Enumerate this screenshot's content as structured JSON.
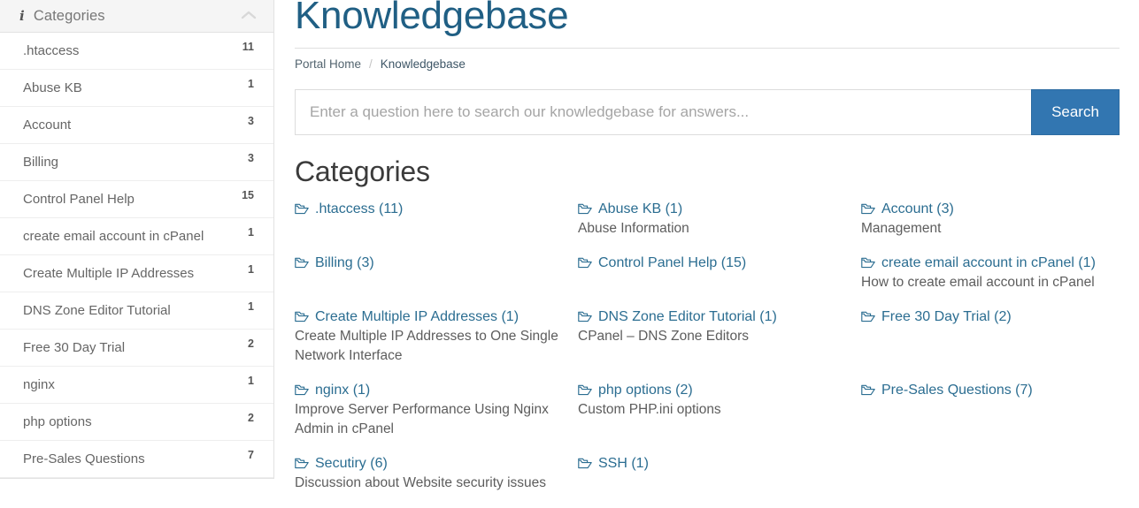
{
  "sidebar": {
    "title": "Categories",
    "info_icon": "info-icon",
    "collapse_icon": "chevron-up-icon",
    "items": [
      {
        "label": ".htaccess",
        "count": "11"
      },
      {
        "label": "Abuse KB",
        "count": "1"
      },
      {
        "label": "Account",
        "count": "3"
      },
      {
        "label": "Billing",
        "count": "3"
      },
      {
        "label": "Control Panel Help",
        "count": "15"
      },
      {
        "label": "create email account in cPanel",
        "count": "1"
      },
      {
        "label": "Create Multiple IP Addresses",
        "count": "1"
      },
      {
        "label": "DNS Zone Editor Tutorial",
        "count": "1"
      },
      {
        "label": "Free 30 Day Trial",
        "count": "2"
      },
      {
        "label": "nginx",
        "count": "1"
      },
      {
        "label": "php options",
        "count": "2"
      },
      {
        "label": "Pre-Sales Questions",
        "count": "7"
      }
    ]
  },
  "main": {
    "title": "Knowledgebase",
    "breadcrumb": {
      "home": "Portal Home",
      "separator": "/",
      "current": "Knowledgebase"
    },
    "search": {
      "placeholder": "Enter a question here to search our knowledgebase for answers...",
      "value": "",
      "button_label": "Search"
    },
    "section_title": "Categories",
    "categories": [
      {
        "label": ".htaccess (11)",
        "desc": "",
        "icon": "folder-open-icon"
      },
      {
        "label": "Abuse KB (1)",
        "desc": "Abuse Information",
        "icon": "folder-open-icon"
      },
      {
        "label": "Account (3)",
        "desc": "Management",
        "icon": "folder-open-icon"
      },
      {
        "label": "Billing (3)",
        "desc": "",
        "icon": "folder-open-icon"
      },
      {
        "label": "Control Panel Help (15)",
        "desc": "",
        "icon": "folder-open-icon"
      },
      {
        "label": "create email account in cPanel (1)",
        "desc": "How to create email account in cPanel",
        "icon": "folder-open-icon"
      },
      {
        "label": "Create Multiple IP Addresses (1)",
        "desc": "Create Multiple IP Addresses to One Single Network Interface",
        "icon": "folder-open-icon"
      },
      {
        "label": "DNS Zone Editor Tutorial (1)",
        "desc": "CPanel – DNS Zone Editors",
        "icon": "folder-open-icon"
      },
      {
        "label": "Free 30 Day Trial (2)",
        "desc": "",
        "icon": "folder-open-icon"
      },
      {
        "label": "nginx (1)",
        "desc": "Improve Server Performance Using Nginx Admin in cPanel",
        "icon": "folder-open-icon"
      },
      {
        "label": "php options (2)",
        "desc": "Custom PHP.ini options",
        "icon": "folder-open-icon"
      },
      {
        "label": "Pre-Sales Questions (7)",
        "desc": "",
        "icon": "folder-open-icon"
      },
      {
        "label": "Secutiry (6)",
        "desc": "Discussion about Website security issues",
        "icon": "folder-open-icon"
      },
      {
        "label": "SSH (1)",
        "desc": "",
        "icon": "folder-open-icon"
      }
    ]
  },
  "colors": {
    "title_blue": "#205f84",
    "link_blue": "#2b6d91",
    "button_blue": "#3276b1",
    "panel_heading_bg": "#f5f5f5",
    "border_gray": "#e2e2e2"
  }
}
